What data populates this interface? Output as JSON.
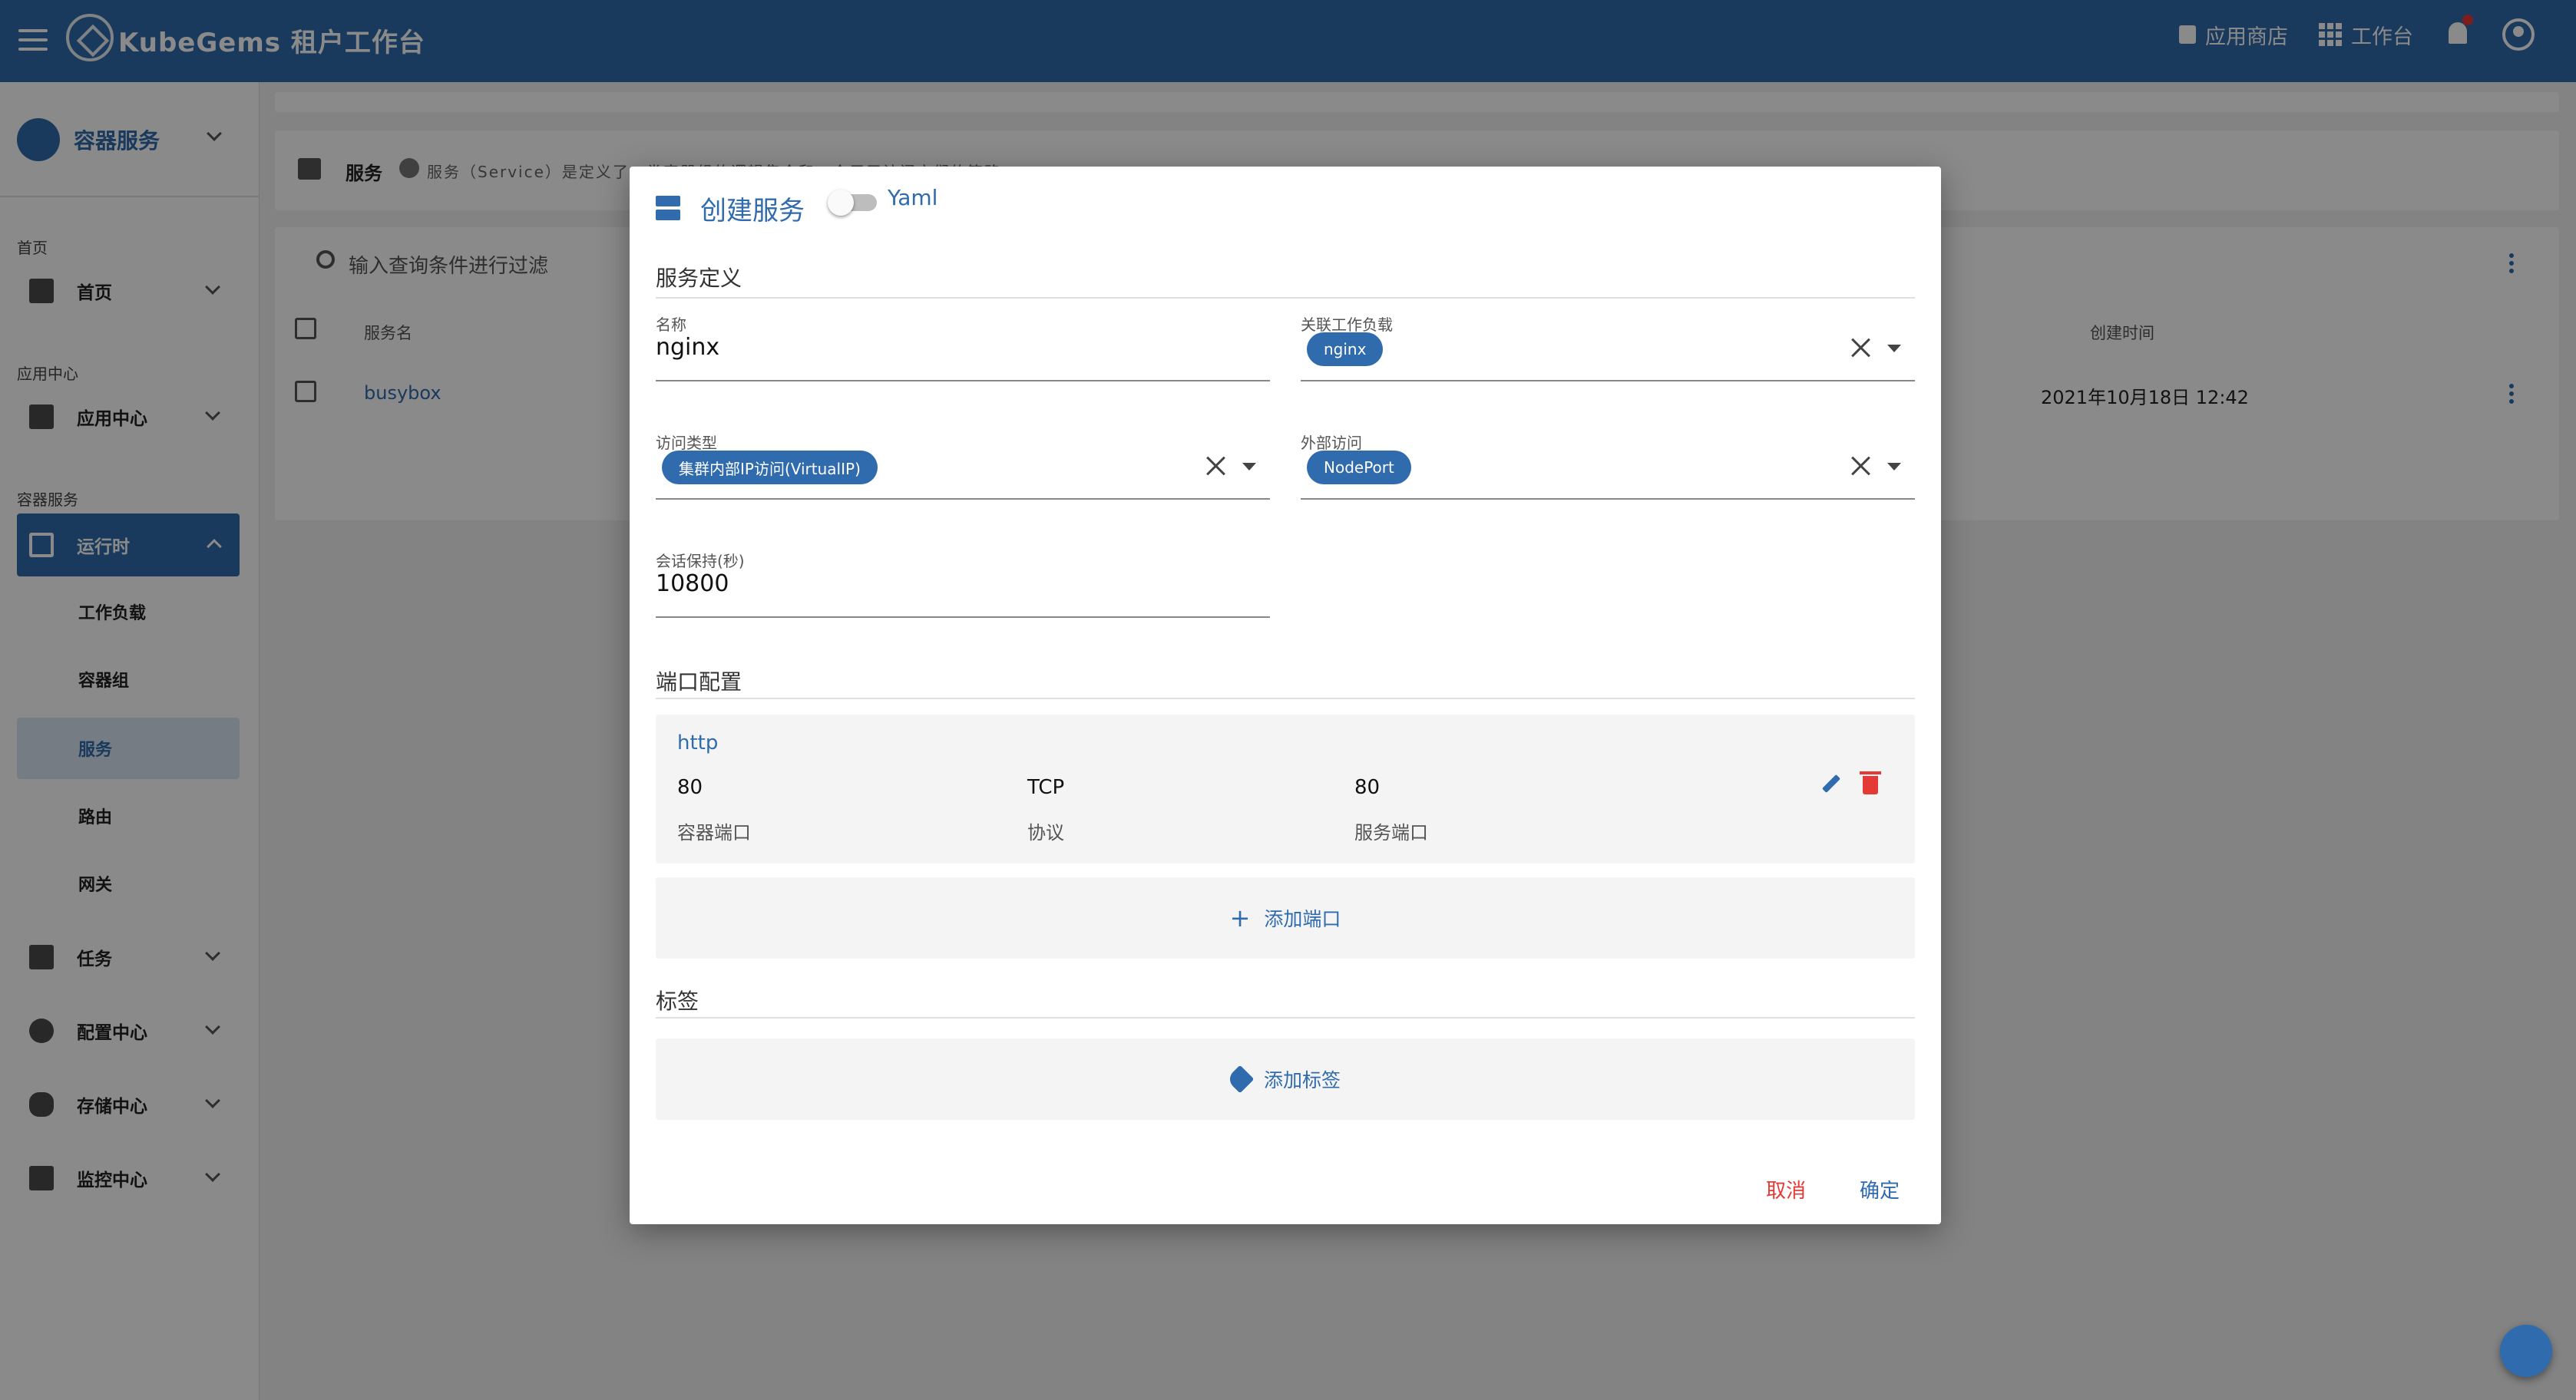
{
  "topbar": {
    "brand": "KubeGems 租户工作台",
    "app_store": "应用商店",
    "workspace": "工作台"
  },
  "sidebar": {
    "header": "容器服务",
    "sections": {
      "home": "首页",
      "app_center": "应用中心",
      "container": "容器服务"
    },
    "items": {
      "home": "首页",
      "app_center": "应用中心",
      "runtime": "运行时",
      "jobs": "任务",
      "config": "配置中心",
      "storage": "存储中心",
      "monitor": "监控中心"
    },
    "runtime_children": [
      "工作负载",
      "容器组",
      "服务",
      "路由",
      "网关"
    ]
  },
  "page": {
    "header_title": "服务",
    "header_desc": "服务（Service）是定义了一类容器组的逻辑集合和一个用于访问它们的策略",
    "filter_placeholder": "输入查询条件进行过滤",
    "columns": {
      "name": "服务名",
      "created": "创建时间"
    },
    "rows": [
      {
        "name": "busybox",
        "created": "2021年10月18日 12:42"
      }
    ]
  },
  "dialog": {
    "title": "创建服务",
    "yaml_label": "Yaml",
    "yaml_enabled": false,
    "section_definition": "服务定义",
    "fields": {
      "name_label": "名称",
      "name_value": "nginx",
      "workload_label": "关联工作负载",
      "workload_chip": "nginx",
      "access_type_label": "访问类型",
      "access_type_chip": "集群内部IP访问(VirtualIP)",
      "external_label": "外部访问",
      "external_chip": "NodePort",
      "session_label": "会话保持(秒)",
      "session_value": "10800"
    },
    "section_ports": "端口配置",
    "port": {
      "name": "http",
      "container_port": "80",
      "container_port_label": "容器端口",
      "protocol": "TCP",
      "protocol_label": "协议",
      "service_port": "80",
      "service_port_label": "服务端口"
    },
    "add_port": "添加端口",
    "section_labels": "标签",
    "add_label": "添加标签",
    "cancel": "取消",
    "confirm": "确定"
  }
}
